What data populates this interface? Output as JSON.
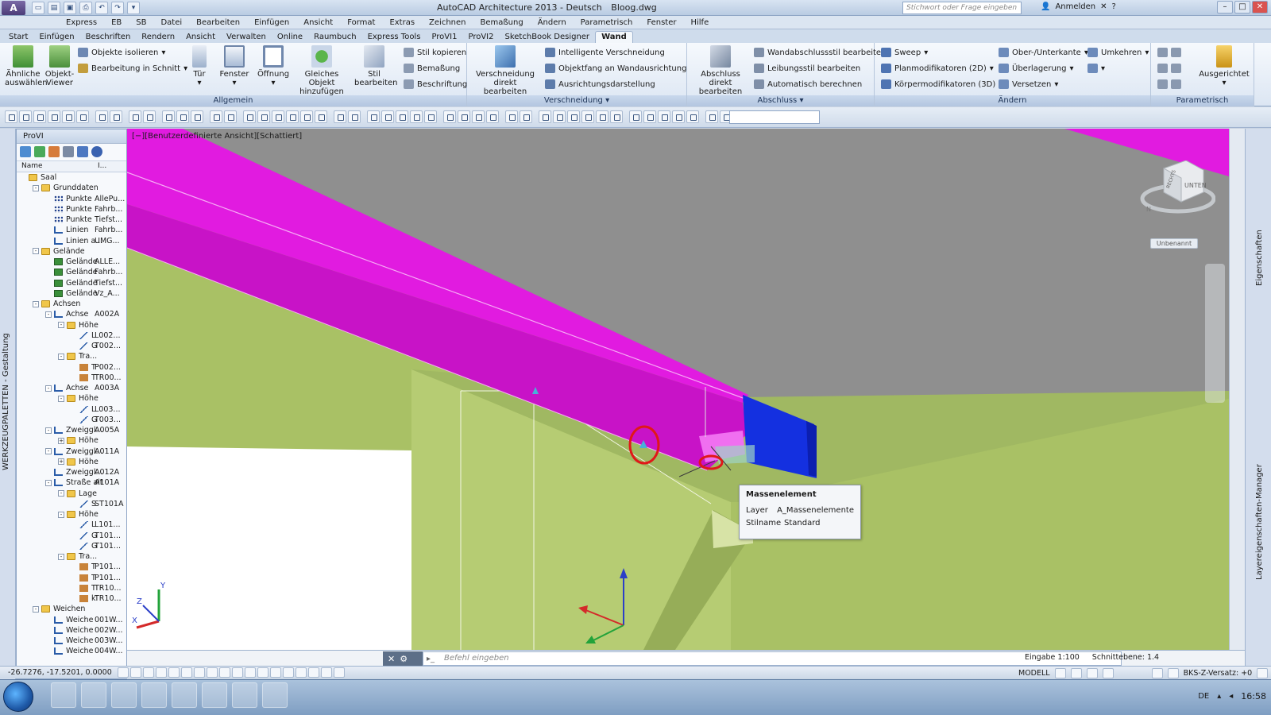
{
  "window": {
    "logo": "A",
    "title_app": "AutoCAD Architecture 2013 - Deutsch",
    "title_file": "Bloog.dwg",
    "search_placeholder": "Stichwort oder Frage eingeben",
    "signin": "Anmelden"
  },
  "menubar": [
    "Express",
    "EB",
    "SB",
    "Datei",
    "Bearbeiten",
    "Einfügen",
    "Ansicht",
    "Format",
    "Extras",
    "Zeichnen",
    "Bemaßung",
    "Ändern",
    "Parametrisch",
    "Fenster",
    "Hilfe"
  ],
  "ribbon_tabs": [
    "Start",
    "Einfügen",
    "Beschriften",
    "Rendern",
    "Ansicht",
    "Verwalten",
    "Online",
    "Raumbuch",
    "Express Tools",
    "ProVI1",
    "ProVI2",
    "SketchBook Designer",
    "Wand"
  ],
  "ribbon_active_tab": "Wand",
  "ribbon": {
    "allgemein": {
      "title": "Allgemein",
      "aehnliche": [
        "Ähnliche",
        "auswählen"
      ],
      "objekt_viewer": [
        "Objekt-",
        "Viewer"
      ],
      "isolieren": "Objekte isolieren",
      "schnitt": "Bearbeitung in Schnitt",
      "tuer": "Tür",
      "fenster": "Fenster",
      "oeffnung": "Öffnung",
      "gleiches": [
        "Gleiches Objekt",
        "hinzufügen"
      ],
      "stil": [
        "Stil",
        "bearbeiten"
      ],
      "stil_kopieren": "Stil kopieren",
      "bemassung": "Bemaßung",
      "beschriftung": "Beschriftung"
    },
    "verschneidung": {
      "title": "Verschneidung",
      "direkt": [
        "Verschneidung",
        "direkt bearbeiten"
      ],
      "intelligente": "Intelligente Verschneidung",
      "objektfang": "Objektfang an Wandausrichtung",
      "ausrichtung": "Ausrichtungsdarstellung"
    },
    "abschluss": {
      "title": "Abschluss",
      "direkt": [
        "Abschluss",
        "direkt bearbeiten"
      ],
      "wandabschluss": "Wandabschlussstil bearbeiten",
      "leibung": "Leibungsstil bearbeiten",
      "auto": "Automatisch berechnen"
    },
    "aendern": {
      "title": "Ändern",
      "sweep": "Sweep",
      "plan": "Planmodifikatoren (2D)",
      "koerper": "Körpermodifikatoren (3D)",
      "oberkante": "Ober-/Unterkante",
      "ueberlagerung": "Überlagerung",
      "versetzen": "Versetzen",
      "umkehren": "Umkehren"
    },
    "parametrisch": {
      "title": "Parametrisch",
      "ausgerichtet": "Ausgerichtet"
    }
  },
  "palette": {
    "vertical_label": "WERKZEUGPALETTEN - Gestaltung",
    "title": "ProVI",
    "col_name": "Name",
    "col_value": "I...",
    "tree": [
      {
        "level": 0,
        "icon": "folder",
        "name": "Saal",
        "value": ""
      },
      {
        "level": 1,
        "icon": "folder",
        "name": "Grunddaten",
        "value": "",
        "exp": "-"
      },
      {
        "level": 2,
        "icon": "pts",
        "name": "Punkte",
        "value": "AllePu..."
      },
      {
        "level": 2,
        "icon": "pts",
        "name": "Punkte",
        "value": "Fahrb..."
      },
      {
        "level": 2,
        "icon": "pts",
        "name": "Punkte",
        "value": "Tiefst..."
      },
      {
        "level": 2,
        "icon": "axis",
        "name": "Linien",
        "value": "Fahrb..."
      },
      {
        "level": 2,
        "icon": "axis",
        "name": "Linien a...",
        "value": "UMG..."
      },
      {
        "level": 1,
        "icon": "folder",
        "name": "Gelände",
        "value": "",
        "exp": "-"
      },
      {
        "level": 2,
        "icon": "ter",
        "name": "Gelände",
        "value": "ALLE..."
      },
      {
        "level": 2,
        "icon": "ter",
        "name": "Gelände",
        "value": "Fahrb..."
      },
      {
        "level": 2,
        "icon": "ter",
        "name": "Gelände",
        "value": "Tiefst..."
      },
      {
        "level": 2,
        "icon": "ter",
        "name": "Gelände",
        "value": "Vz_A..."
      },
      {
        "level": 1,
        "icon": "folder",
        "name": "Achsen",
        "value": "",
        "exp": "-"
      },
      {
        "level": 2,
        "icon": "axis",
        "name": "Achse",
        "value": "A002A",
        "exp": "-"
      },
      {
        "level": 3,
        "icon": "folder",
        "name": "Höhe",
        "value": "",
        "exp": "-"
      },
      {
        "level": 4,
        "icon": "prof",
        "name": "L",
        "value": "L002..."
      },
      {
        "level": 4,
        "icon": "prof",
        "name": "G",
        "value": "T002..."
      },
      {
        "level": 3,
        "icon": "folder",
        "name": "Tra...",
        "value": "",
        "exp": "-"
      },
      {
        "level": 4,
        "icon": "tra",
        "name": "T",
        "value": "P002..."
      },
      {
        "level": 4,
        "icon": "tra",
        "name": "T",
        "value": "TR00..."
      },
      {
        "level": 2,
        "icon": "axis",
        "name": "Achse",
        "value": "A003A",
        "exp": "-"
      },
      {
        "level": 3,
        "icon": "folder",
        "name": "Höhe",
        "value": "",
        "exp": "-"
      },
      {
        "level": 4,
        "icon": "prof",
        "name": "L",
        "value": "L003..."
      },
      {
        "level": 4,
        "icon": "prof",
        "name": "G",
        "value": "T003..."
      },
      {
        "level": 2,
        "icon": "axis",
        "name": "Zweiggl...",
        "value": "A005A",
        "exp": "-"
      },
      {
        "level": 3,
        "icon": "folder",
        "name": "Höhe",
        "value": "",
        "exp": "+"
      },
      {
        "level": 2,
        "icon": "axis",
        "name": "Zweiggl...",
        "value": "A011A",
        "exp": "-"
      },
      {
        "level": 3,
        "icon": "folder",
        "name": "Höhe",
        "value": "",
        "exp": "+"
      },
      {
        "level": 2,
        "icon": "axis",
        "name": "Zweiggl...",
        "value": "A012A"
      },
      {
        "level": 2,
        "icon": "axis",
        "name": "Straße alt",
        "value": "A101A",
        "exp": "-"
      },
      {
        "level": 3,
        "icon": "folder",
        "name": "Lage",
        "value": "",
        "exp": "-"
      },
      {
        "level": 4,
        "icon": "prof",
        "name": "S",
        "value": "ST101A"
      },
      {
        "level": 3,
        "icon": "folder",
        "name": "Höhe",
        "value": "",
        "exp": "-"
      },
      {
        "level": 4,
        "icon": "prof",
        "name": "L",
        "value": "L101..."
      },
      {
        "level": 4,
        "icon": "prof",
        "name": "G",
        "value": "T101..."
      },
      {
        "level": 4,
        "icon": "prof",
        "name": "G",
        "value": "T101..."
      },
      {
        "level": 3,
        "icon": "folder",
        "name": "Tra...",
        "value": "",
        "exp": "-"
      },
      {
        "level": 4,
        "icon": "tra",
        "name": "T",
        "value": "P101..."
      },
      {
        "level": 4,
        "icon": "tra",
        "name": "T",
        "value": "P101..."
      },
      {
        "level": 4,
        "icon": "tra",
        "name": "T",
        "value": "TR10..."
      },
      {
        "level": 4,
        "icon": "tra",
        "name": "k",
        "value": "TR10..."
      },
      {
        "level": 1,
        "icon": "folder",
        "name": "Weichen",
        "value": "",
        "exp": "-"
      },
      {
        "level": 2,
        "icon": "axis",
        "name": "Weiche",
        "value": "001W..."
      },
      {
        "level": 2,
        "icon": "axis",
        "name": "Weiche",
        "value": "002W..."
      },
      {
        "level": 2,
        "icon": "axis",
        "name": "Weiche",
        "value": "003W..."
      },
      {
        "level": 2,
        "icon": "axis",
        "name": "Weiche",
        "value": "004W..."
      }
    ]
  },
  "viewport": {
    "label": "[−][Benutzerdefinierte Ansicht][Schattiert]",
    "viewcube_label": "UNTEN",
    "viewcube_side": "RECHTS",
    "compass_n": "N",
    "unnamed": "Unbenannt",
    "colors": {
      "beam": "#e11be0",
      "beam_dark": "#b20fb0",
      "endcap": "#1430e0",
      "ground": "#a9c165",
      "sky": "#8f8f8f"
    }
  },
  "tooltip": {
    "title": "Massenelement",
    "layer_key": "Layer",
    "layer_val": "A_Massenelemente",
    "style_key": "Stilname",
    "style_val": "Standard"
  },
  "right_strip": {
    "props": "Eigenschaften",
    "layers": "Layereigenschaften-Manager"
  },
  "command": {
    "placeholder": "Befehl eingeben",
    "prompt": "▸_",
    "scale": "Eingabe 1:100",
    "schnitt": "Schnittebene: 1.4"
  },
  "statusbar": {
    "coords": "-26.7276, -17.5201, 0.0000",
    "model": "MODELL",
    "bks": "BKS-Z-Versatz: +0"
  },
  "taskbar": {
    "lang": "DE",
    "time": "16:58"
  }
}
